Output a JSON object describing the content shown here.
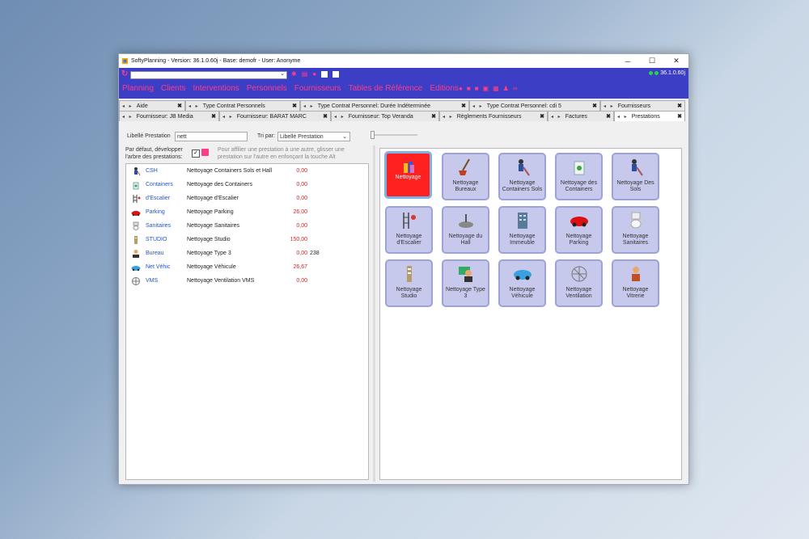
{
  "window": {
    "title": "SoftyPlanning - Version: 36.1.0.60j - Base: demofr - User: Anonyme",
    "minimize": "─",
    "maximize": "☐",
    "close": "✕"
  },
  "toolbar": {
    "combo_value": "",
    "version": "36.1.0.60j",
    "menu": [
      "Planning",
      "Clients",
      "Interventions",
      "Personnels",
      "Fournisseurs",
      "Tables de Référence",
      "Editions"
    ]
  },
  "tabs_row1": [
    {
      "label": "Aide"
    },
    {
      "label": "Type Contrat Personnels"
    },
    {
      "label": "Type Contrat Personnel: Durée Indéterminée"
    },
    {
      "label": "Type Contrat Personnel: cdi 5"
    },
    {
      "label": "Fournisseurs"
    }
  ],
  "tabs_row2": [
    {
      "label": "Fournisseur: JB Media"
    },
    {
      "label": "Fournisseur: BARAT MARC"
    },
    {
      "label": "Fournisseur: Top Veranda"
    },
    {
      "label": "Règlements Fournisseurs"
    },
    {
      "label": "Factures"
    },
    {
      "label": "Prestations"
    }
  ],
  "filter": {
    "libelle_label": "Libellé Prestation",
    "libelle_value": "nett",
    "tri_label": "Tri par:",
    "tri_value": "Libellé Prestation"
  },
  "options": {
    "expand_label_1": "Par défaut, développer",
    "expand_label_2": "l'arbre des prestations:",
    "expand_checked": "✓",
    "hint_1": "Pour affilier une prestation à une autre, glisser une",
    "hint_2": "prestation sur l'autre en enfonçant la touche Alt"
  },
  "prestations": [
    {
      "code": "CSH",
      "name": "Nettoyage Containers Sols et Hall",
      "value": "0,00",
      "extra": ""
    },
    {
      "code": "Containers",
      "name": "Nettoyage des Containers",
      "value": "0,00",
      "extra": ""
    },
    {
      "code": "d'Escalier",
      "name": "Nettoyage d'Escalier",
      "value": "0,00",
      "extra": ""
    },
    {
      "code": "Parking",
      "name": "Nettoyage Parking",
      "value": "26,00",
      "extra": ""
    },
    {
      "code": "Sanitaires",
      "name": "Nettoyage Sanitaires",
      "value": "0,00",
      "extra": ""
    },
    {
      "code": "STUDIO",
      "name": "Nettoyage Studio",
      "value": "150,00",
      "extra": ""
    },
    {
      "code": "Bureau",
      "name": "Nettoyage Type 3",
      "value": "0,00",
      "extra": "238"
    },
    {
      "code": "Net Véhic",
      "name": "Nettoyage Véhicule",
      "value": "26,67",
      "extra": ""
    },
    {
      "code": "VMS",
      "name": "Nettoyage Ventilation VMS",
      "value": "0,00",
      "extra": ""
    }
  ],
  "tiles": [
    {
      "label": "Nettoyage"
    },
    {
      "label": "Nettoyage Bureaux"
    },
    {
      "label": "Nettoyage Containers Sols"
    },
    {
      "label": "Nettoyage des Containers"
    },
    {
      "label": "Nettoyage Des Sols"
    },
    {
      "label": "Nettoyage d'Escalier"
    },
    {
      "label": "Nettoyage du Hall"
    },
    {
      "label": "Nettoyage Immeuble"
    },
    {
      "label": "Nettoyage Parking"
    },
    {
      "label": "Nettoyage Sanitaires"
    },
    {
      "label": "Nettoyage Studio"
    },
    {
      "label": "Nettoyage Type 3"
    },
    {
      "label": "Nettoyage Véhicule"
    },
    {
      "label": "Nettoyage Ventilation"
    },
    {
      "label": "Nettoyage Vitrerie"
    }
  ],
  "colors": {
    "accent": "#ff3c86",
    "toolbar": "#3c3ec6",
    "value_red": "#e02020",
    "link_blue": "#2255cc",
    "tile_bg": "#c6c9ec",
    "tile_selected": "#ff2020"
  }
}
